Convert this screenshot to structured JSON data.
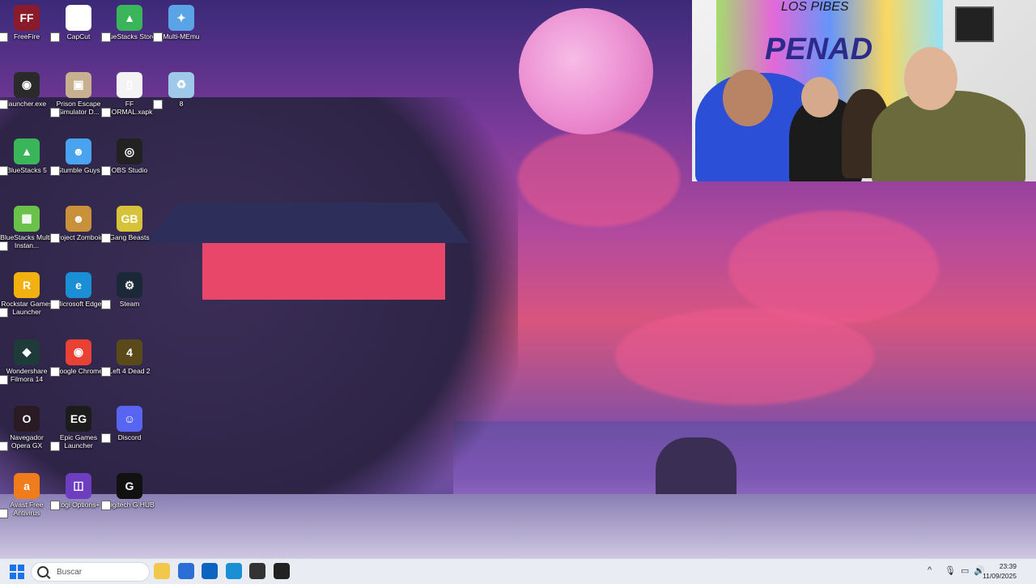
{
  "desktop": {
    "icons": [
      {
        "label": "FreeFire",
        "color": "#8a1b2a",
        "glyph": "FF"
      },
      {
        "label": "CapCut",
        "color": "#ffffff",
        "glyph": "✂"
      },
      {
        "label": "BlueStacks Store",
        "color": "#3bb55a",
        "glyph": "▲"
      },
      {
        "label": "Multi-MEmu",
        "color": "#5aa3e6",
        "glyph": "✦"
      },
      {
        "label": "launcher.exe",
        "color": "#2a2a2a",
        "glyph": "◉"
      },
      {
        "label": "Prison Escape Simulator D...",
        "color": "#c7b08f",
        "glyph": "▣"
      },
      {
        "label": "FF NORMAL.xapk",
        "color": "#f3f3f3",
        "glyph": "▯"
      },
      {
        "label": "8",
        "color": "#9fc9e8",
        "glyph": "♻"
      },
      {
        "label": "BlueStacks 5",
        "color": "#3bb55a",
        "glyph": "▲"
      },
      {
        "label": "Stumble Guys",
        "color": "#4aa3ef",
        "glyph": "☻"
      },
      {
        "label": "OBS Studio",
        "color": "#222222",
        "glyph": "◎"
      },
      {
        "label": "BlueStacks Multi-Instan...",
        "color": "#6ac24b",
        "glyph": "▦"
      },
      {
        "label": "Project Zomboid",
        "color": "#c8913a",
        "glyph": "☻"
      },
      {
        "label": "Gang Beasts",
        "color": "#d6c33a",
        "glyph": "GB"
      },
      {
        "label": "Rockstar Games Launcher",
        "color": "#f3b10f",
        "glyph": "R"
      },
      {
        "label": "Microsoft Edge",
        "color": "#1a8fd6",
        "glyph": "e"
      },
      {
        "label": "Steam",
        "color": "#1b2838",
        "glyph": "⚙"
      },
      {
        "label": "Wondershare Filmora 14",
        "color": "#1e3b3a",
        "glyph": "◆"
      },
      {
        "label": "Google Chrome",
        "color": "#e94235",
        "glyph": "◉"
      },
      {
        "label": "Left 4 Dead 2",
        "color": "#5a4a1a",
        "glyph": "4"
      },
      {
        "label": "Navegador Opera GX",
        "color": "#2a1a24",
        "glyph": "O"
      },
      {
        "label": "Epic Games Launcher",
        "color": "#1c1c1c",
        "glyph": "EG"
      },
      {
        "label": "Discord",
        "color": "#5865f2",
        "glyph": "☺"
      },
      {
        "label": "Avast Free Antivirus",
        "color": "#f07c1b",
        "glyph": "a"
      },
      {
        "label": "Logi Options+",
        "color": "#6d3fc0",
        "glyph": "◫"
      },
      {
        "label": "Logitech G HUB",
        "color": "#111111",
        "glyph": "G"
      }
    ]
  },
  "webcam": {
    "graffiti_text": "LOS PIBES",
    "graffiti_big": "PENAD",
    "colors": {
      "hoodie_blue": "#2b4fd6",
      "jacket_olive": "#6b6a3c",
      "shirt_black": "#1b1b1b"
    }
  },
  "taskbar": {
    "search_placeholder": "Buscar",
    "apps": [
      {
        "name": "file-explorer",
        "color": "#f2c84b"
      },
      {
        "name": "microsoft-store",
        "color": "#2b6fd6"
      },
      {
        "name": "outlook",
        "color": "#0a64c0"
      },
      {
        "name": "edge",
        "color": "#1a8fd6"
      },
      {
        "name": "app-dark",
        "color": "#333333"
      },
      {
        "name": "obs",
        "color": "#222222"
      }
    ],
    "tray": {
      "chevron": "^",
      "mic": "🎙",
      "network": "▭",
      "volume": "🔊"
    },
    "time": "23:39",
    "date": "11/09/2025"
  }
}
